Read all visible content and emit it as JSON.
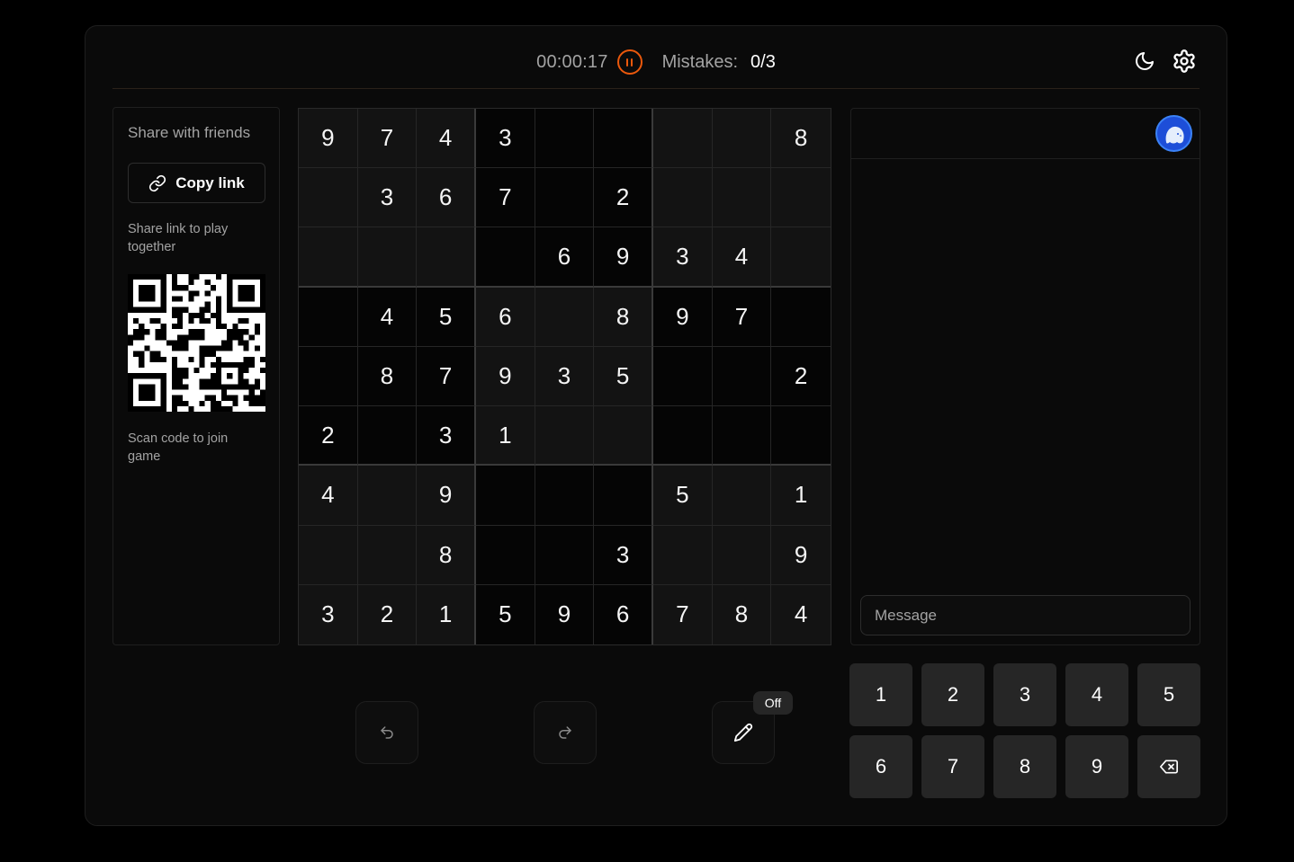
{
  "header": {
    "timer": "00:00:17",
    "mistakes_label": "Mistakes:",
    "mistakes_value": "0/3",
    "accent": "#ea580c",
    "icons": [
      "pause-icon",
      "moon-icon",
      "gear-icon"
    ]
  },
  "share": {
    "title": "Share with friends",
    "copy_label": "Copy link",
    "link_hint": "Share link to play together",
    "scan_hint": "Scan code to join game"
  },
  "board": {
    "rows": [
      [
        "9",
        "7",
        "4",
        "3",
        "",
        "",
        "",
        "",
        "8"
      ],
      [
        "",
        "3",
        "6",
        "7",
        "",
        "2",
        "",
        "",
        ""
      ],
      [
        "",
        "",
        "",
        "",
        "6",
        "9",
        "3",
        "4",
        ""
      ],
      [
        "",
        "4",
        "5",
        "6",
        "",
        "8",
        "9",
        "7",
        ""
      ],
      [
        "",
        "8",
        "7",
        "9",
        "3",
        "5",
        "",
        "",
        "2"
      ],
      [
        "2",
        "",
        "3",
        "1",
        "",
        "",
        "",
        "",
        ""
      ],
      [
        "4",
        "",
        "9",
        "",
        "",
        "",
        "5",
        "",
        "1"
      ],
      [
        "",
        "",
        "8",
        "",
        "",
        "3",
        "",
        "",
        "9"
      ],
      [
        "3",
        "2",
        "1",
        "5",
        "9",
        "6",
        "7",
        "8",
        "4"
      ]
    ]
  },
  "chat": {
    "message_placeholder": "Message",
    "avatar_color": "#3b82f6"
  },
  "controls": {
    "notes_state": "Off"
  },
  "numpad": {
    "keys": [
      "1",
      "2",
      "3",
      "4",
      "5",
      "6",
      "7",
      "8",
      "9"
    ]
  }
}
